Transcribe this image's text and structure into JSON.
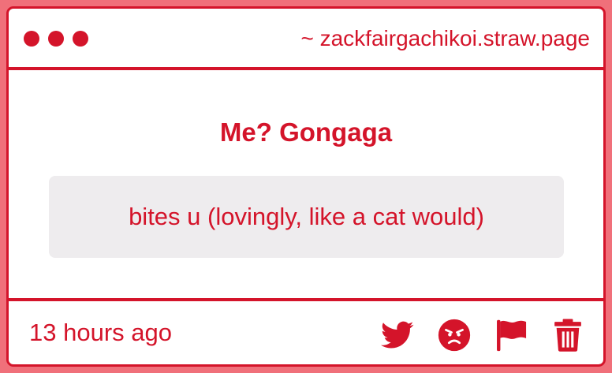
{
  "window": {
    "url": "~ zackfairgachikoi.straw.page"
  },
  "question": {
    "text": "Me? Gongaga"
  },
  "answer": {
    "text": "bites u (lovingly, like a cat would)"
  },
  "footer": {
    "timestamp": "13 hours ago",
    "actions": [
      {
        "icon": "twitter-icon"
      },
      {
        "icon": "angry-face-icon"
      },
      {
        "icon": "flag-icon"
      },
      {
        "icon": "trash-icon"
      }
    ]
  },
  "colors": {
    "accent": "#d4142a",
    "page_background": "#f0707a",
    "card_background": "#ffffff",
    "answer_background": "#eeecee"
  }
}
